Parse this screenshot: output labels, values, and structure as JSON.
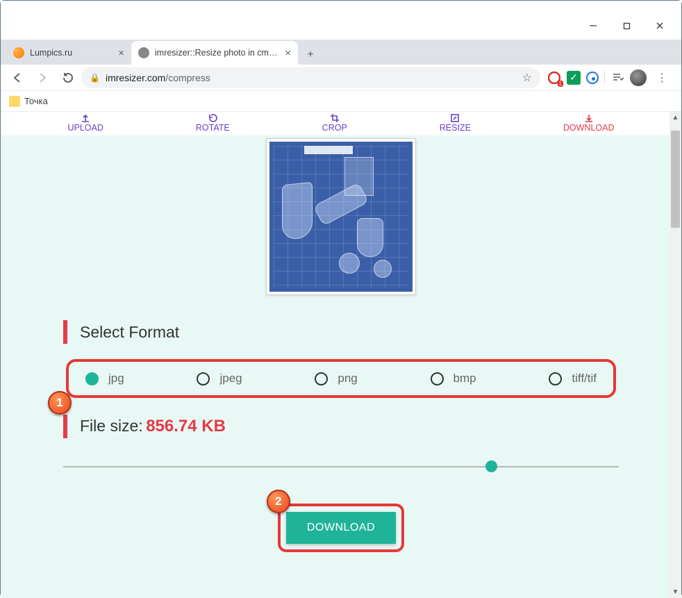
{
  "window": {
    "tabs": [
      {
        "title": "Lumpics.ru",
        "active": false
      },
      {
        "title": "imresizer::Resize photo in cm, mm",
        "active": true
      }
    ]
  },
  "addressbar": {
    "host": "imresizer.com",
    "path": "/compress"
  },
  "bookmark": {
    "label": "Точка"
  },
  "steps": {
    "upload": "UPLOAD",
    "rotate": "ROTATE",
    "crop": "CROP",
    "resize": "RESIZE",
    "download": "DOWNLOAD"
  },
  "section_format_title": "Select Format",
  "formats": {
    "jpg": "jpg",
    "jpeg": "jpeg",
    "png": "png",
    "bmp": "bmp",
    "tiff": "tiff/tif"
  },
  "filesize": {
    "label": "File size:",
    "value": "856.74 KB"
  },
  "download_button": "DOWNLOAD",
  "callouts": {
    "one": "1",
    "two": "2"
  }
}
